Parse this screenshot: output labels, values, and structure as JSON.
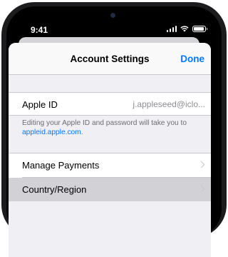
{
  "status_bar": {
    "time": "9:41",
    "signal_icon": "cellular-signal-icon",
    "wifi_icon": "wifi-icon",
    "battery_icon": "battery-icon"
  },
  "navbar": {
    "title": "Account Settings",
    "done_label": "Done"
  },
  "apple_id": {
    "label": "Apple ID",
    "value": "j.appleseed@iclo..."
  },
  "note": {
    "text": "Editing your Apple ID and password will take you to",
    "link": "appleid.apple.com",
    "suffix": "."
  },
  "rows": [
    {
      "label": "Manage Payments",
      "icon": "chevron-right-icon"
    },
    {
      "label": "Country/Region",
      "icon": "chevron-right-icon"
    }
  ],
  "colors": {
    "accent": "#007aff",
    "background": "#efeff4",
    "highlight_row": "#d1d1d6"
  }
}
